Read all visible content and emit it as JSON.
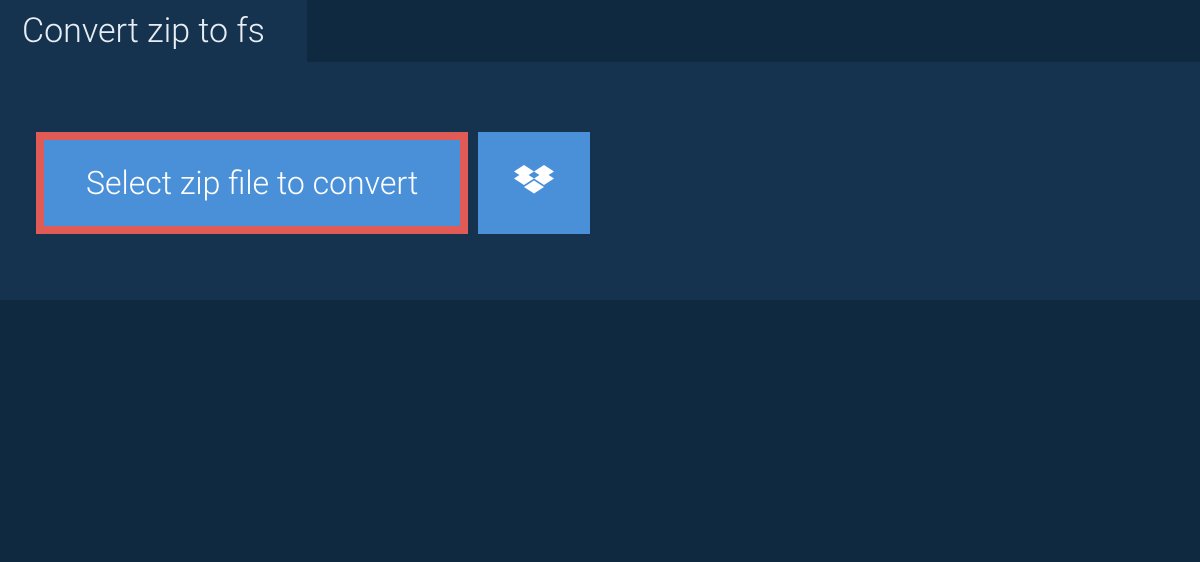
{
  "tab": {
    "title": "Convert zip to fs"
  },
  "actions": {
    "select_file_label": "Select zip file to convert"
  }
}
